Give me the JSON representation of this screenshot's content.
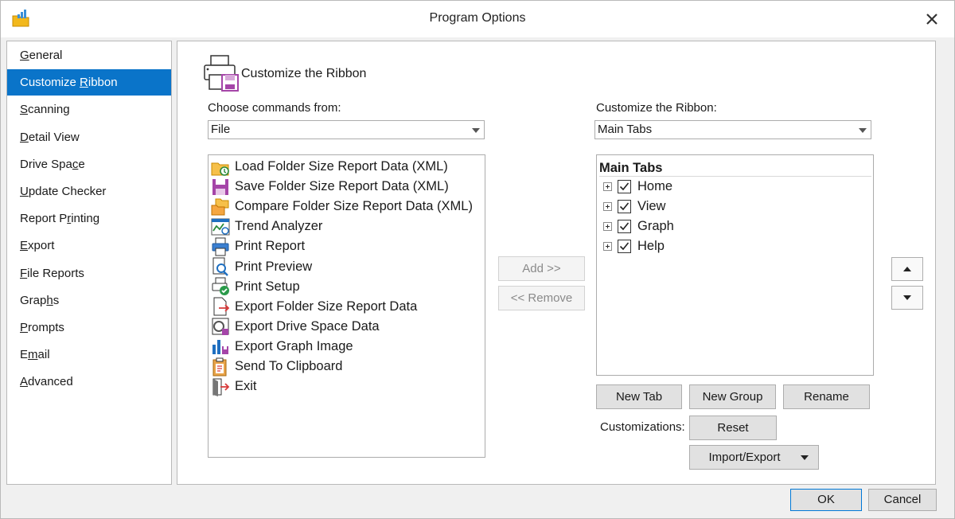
{
  "window": {
    "title": "Program Options",
    "close_icon": "close-icon",
    "app_icon": "folder-chart-icon"
  },
  "nav": {
    "items": [
      {
        "pre": "",
        "key": "G",
        "post": "eneral",
        "active": false
      },
      {
        "pre": "Customize ",
        "key": "R",
        "post": "ibbon",
        "active": true
      },
      {
        "pre": "",
        "key": "S",
        "post": "canning",
        "active": false
      },
      {
        "pre": "",
        "key": "D",
        "post": "etail View",
        "active": false
      },
      {
        "pre": "Drive Spa",
        "key": "c",
        "post": "e",
        "active": false
      },
      {
        "pre": "",
        "key": "U",
        "post": "pdate Checker",
        "active": false
      },
      {
        "pre": "Report P",
        "key": "r",
        "post": "inting",
        "active": false
      },
      {
        "pre": "",
        "key": "E",
        "post": "xport",
        "active": false
      },
      {
        "pre": "",
        "key": "F",
        "post": "ile Reports",
        "active": false
      },
      {
        "pre": "Grap",
        "key": "h",
        "post": "s",
        "active": false
      },
      {
        "pre": "",
        "key": "P",
        "post": "rompts",
        "active": false
      },
      {
        "pre": "E",
        "key": "m",
        "post": "ail",
        "active": false
      },
      {
        "pre": "",
        "key": "A",
        "post": "dvanced",
        "active": false
      }
    ]
  },
  "header": {
    "title": "Customize the Ribbon",
    "icon": "printer-save-icon"
  },
  "commands": {
    "label": "Choose commands from:",
    "selected": "File",
    "items": [
      {
        "label": "Load Folder Size Report Data (XML)",
        "icon": "load-folder-icon"
      },
      {
        "label": "Save Folder Size Report Data (XML)",
        "icon": "save-disk-icon"
      },
      {
        "label": "Compare Folder Size Report Data (XML)",
        "icon": "compare-folders-icon"
      },
      {
        "label": "Trend Analyzer",
        "icon": "trend-analyzer-icon"
      },
      {
        "label": "Print Report",
        "icon": "printer-icon"
      },
      {
        "label": "Print Preview",
        "icon": "print-preview-icon"
      },
      {
        "label": "Print Setup",
        "icon": "print-setup-icon"
      },
      {
        "label": "Export Folder Size Report Data",
        "icon": "export-data-icon"
      },
      {
        "label": "Export Drive Space Data",
        "icon": "export-drive-icon"
      },
      {
        "label": "Export Graph Image",
        "icon": "export-graph-icon"
      },
      {
        "label": "Send To Clipboard",
        "icon": "clipboard-icon"
      },
      {
        "label": "Exit",
        "icon": "exit-door-icon"
      }
    ]
  },
  "actions": {
    "add": "Add >>",
    "remove": "<< Remove"
  },
  "ribbon": {
    "label": "Customize the Ribbon:",
    "selected": "Main Tabs",
    "root": "Main Tabs",
    "tabs": [
      {
        "label": "Home",
        "checked": true
      },
      {
        "label": "View",
        "checked": true
      },
      {
        "label": "Graph",
        "checked": true
      },
      {
        "label": "Help",
        "checked": true
      }
    ]
  },
  "tab_buttons": {
    "new_tab": "New Tab",
    "new_group": "New Group",
    "rename": "Rename"
  },
  "customizations": {
    "label": "Customizations:",
    "reset": "Reset",
    "import_export": "Import/Export"
  },
  "footer": {
    "ok": "OK",
    "cancel": "Cancel"
  }
}
